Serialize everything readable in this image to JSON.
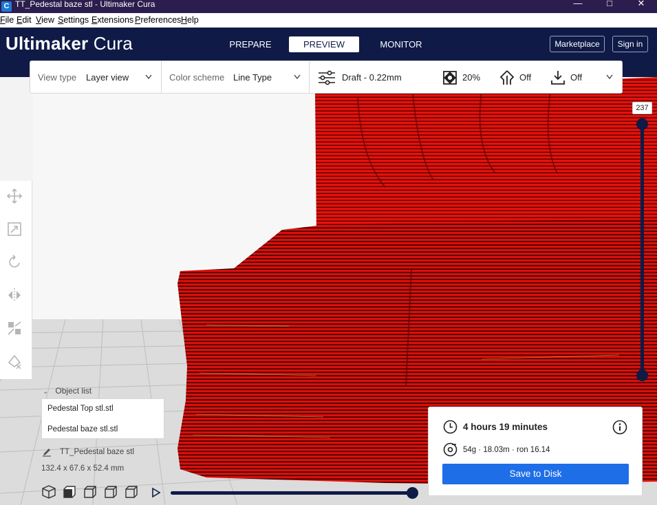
{
  "window": {
    "title": "TT_Pedestal baze stl - Ultimaker Cura"
  },
  "menu": [
    "File",
    "Edit",
    "View",
    "Settings",
    "Extensions",
    "Preferences",
    "Help"
  ],
  "header": {
    "brand_bold": "Ultimaker",
    "brand_light": "Cura",
    "tabs": [
      "PREPARE",
      "PREVIEW",
      "MONITOR"
    ],
    "active_tab": "PREVIEW",
    "marketplace": "Marketplace",
    "signin": "Sign in"
  },
  "toolbar": {
    "view_type_label": "View type",
    "view_type_value": "Layer view",
    "color_scheme_label": "Color scheme",
    "color_scheme_value": "Line Type",
    "profile": "Draft - 0.22mm",
    "infill": "20%",
    "support": "Off",
    "adhesion": "Off"
  },
  "layer_slider": {
    "current_layer": "237"
  },
  "object_list": {
    "title": "Object list",
    "items": [
      "Pedestal Top stl.stl",
      "Pedestal baze stl.stl"
    ],
    "selected_name": "TT_Pedestal baze stl",
    "dimensions": "132.4 x 67.6 x 52.4 mm"
  },
  "print_info": {
    "time": "4 hours 19 minutes",
    "material": "54g · 18.03m · ron 16.14",
    "save_button": "Save to Disk"
  },
  "colors": {
    "header_bg": "#0f1a47",
    "model_red": "#e0140f",
    "save_blue": "#1e6ee8",
    "titlebar_bg": "#2b1d4d"
  }
}
